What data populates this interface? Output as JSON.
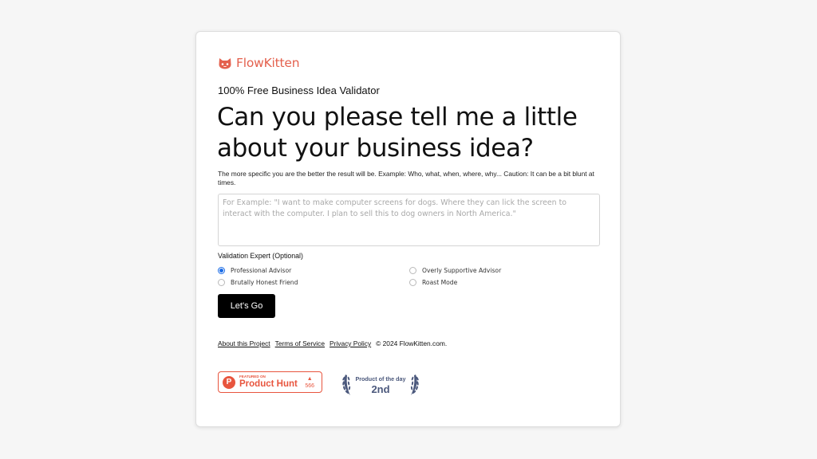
{
  "brand": {
    "name": "FlowKitten",
    "logo_icon": "cat-face-icon",
    "color": "#e4614e"
  },
  "form": {
    "subtitle": "100% Free Business Idea Validator",
    "headline": "Can you please tell me a little about your business idea?",
    "helper": "The more specific you are the better the result will be. Example: Who, what, when, where, why... Caution: It can be a bit blunt at times.",
    "idea_value": "",
    "idea_placeholder": "For Example: \"I want to make computer screens for dogs. Where they can lick the screen to interact with the computer. I plan to sell this to dog owners in North America.\"",
    "expert_label": "Validation Expert (Optional)",
    "experts": [
      {
        "label": "Professional Advisor",
        "checked": true
      },
      {
        "label": "Brutally Honest Friend",
        "checked": false
      },
      {
        "label": "Overly Supportive Advisor",
        "checked": false
      },
      {
        "label": "Roast Mode",
        "checked": false
      }
    ],
    "submit_label": "Let's Go",
    "accent_color": "#1a6be6"
  },
  "footer": {
    "about": "About this Project",
    "terms": "Terms of Service",
    "privacy": "Privacy Policy",
    "copyright": "© 2024 FlowKitten.com."
  },
  "badges": {
    "product_hunt": {
      "featured": "FEATURED ON",
      "name": "Product Hunt",
      "votes": "566",
      "color": "#e8553e"
    },
    "product_of_day": {
      "title": "Product of the day",
      "rank": "2nd",
      "color": "#4b587c"
    }
  }
}
